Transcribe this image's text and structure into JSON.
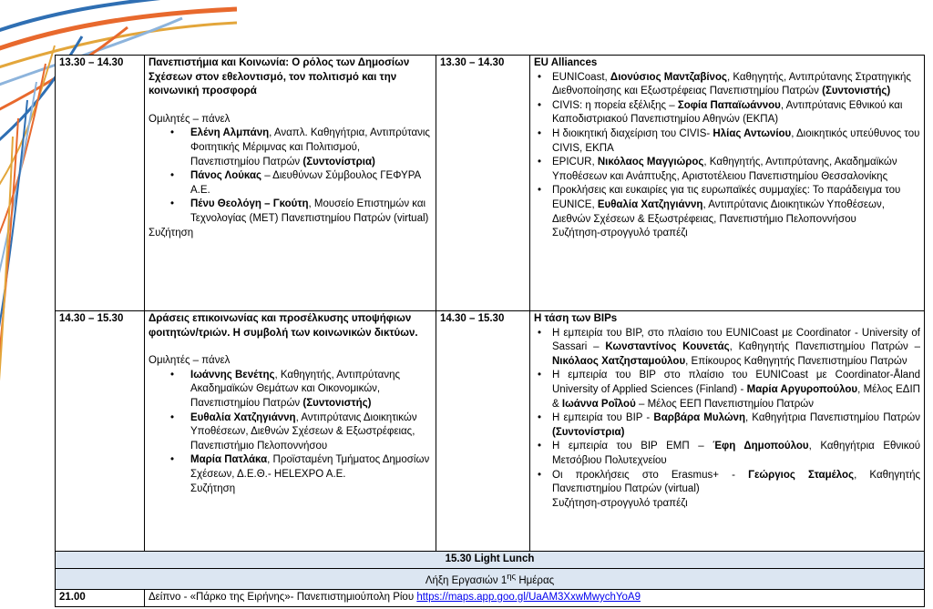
{
  "colors": {
    "band_bg": "#dce6f2",
    "link": "#0000ee",
    "deco_orange": "#e8692d",
    "deco_blue": "#2f6fb3",
    "deco_gold": "#e3a63b"
  },
  "row1": {
    "left": {
      "time": "13.30 – 14.30",
      "title": "Πανεπιστήμια και Κοινωνία: Ο ρόλος των Δημοσίων Σχέσεων στον εθελοντισμό, τον πολιτισμό και την κοινωνική προσφορά",
      "panel_label": "Ομιλητές – πάνελ",
      "speakers": [
        {
          "name": "Ελένη Αλμπάνη",
          "role": ", Αναπλ. Καθηγήτρια, Αντιπρύτανις Φοιτητικής Μέριμνας και Πολιτισμού, Πανεπιστημίου Πατρών ",
          "tag": "(Συντονίστρια)"
        },
        {
          "name": "Πάνος Λούκας",
          "role": " – Διευθύνων Σύμβουλος ΓΕΦΥΡΑ Α.Ε.",
          "tag": ""
        },
        {
          "name": "Πένυ Θεολόγη – Γκούτη",
          "role": ", Μουσείο Επιστημών και Τεχνολογίας (ΜΕΤ) Πανεπιστημίου Πατρών (virtual)",
          "tag": ""
        }
      ],
      "discussion": "Συζήτηση"
    },
    "right": {
      "time": "13.30 – 14.30",
      "title": "EU Alliances",
      "items": [
        {
          "pre": "EUNICoast, ",
          "bold": "Διονύσιος Μαντζαβίνος",
          "post": ", Καθηγητής, Αντιπρύτανης Στρατηγικής Διεθνοποίησης και Εξωστρέφειας Πανεπιστημίου Πατρών ",
          "tag": "(Συντονιστής)"
        },
        {
          "pre": "CIVIS: η πορεία εξέλιξης – ",
          "bold": "Σοφία Παπαϊωάννου",
          "post": ", Αντιπρύτανις Εθνικού και Καποδιστριακού Πανεπιστημίου Αθηνών (ΕΚΠΑ)",
          "tag": ""
        },
        {
          "pre": "Η διοικητική διαχείριση του CIVIS- ",
          "bold": "Ηλίας Αντωνίου",
          "post": ", Διοικητικός υπεύθυνος του CIVIS, ΕΚΠΑ",
          "tag": ""
        },
        {
          "pre": "EPICUR, ",
          "bold": "Νικόλαος Μαγγιώρος",
          "post": ", Καθηγητής, Αντιπρύτανης, Ακαδημαϊκών Υποθέσεων και Ανάπτυξης, Αριστοτέλειου Πανεπιστημίου Θεσσαλονίκης",
          "tag": ""
        },
        {
          "pre": "Προκλήσεις και ευκαιρίες για τις ευρωπαϊκές συμμαχίες: Το παράδειγμα του EUNICE, ",
          "bold": "Ευθαλία Χατζηγιάννη",
          "post": ", Αντιπρύτανις Διοικητικών Υποθέσεων, Διεθνών Σχέσεων & Εξωστρέφειας, Πανεπιστήμιο Πελοποννήσου",
          "tag": ""
        }
      ],
      "discussion": "Συζήτηση-στρογγυλό τραπέζι"
    }
  },
  "row2": {
    "left": {
      "time": "14.30 – 15.30",
      "title": "Δράσεις επικοινωνίας και προσέλκυσης υποψήφιων φοιτητών/τριών. Η συμβολή των κοινωνικών δικτύων.",
      "panel_label": "Ομιλητές – πάνελ",
      "speakers": [
        {
          "name": "Ιωάννης Βενέτης",
          "role": ", Καθηγητής, Αντιπρύτανης Ακαδημαϊκών Θεμάτων και Οικονομικών, Πανεπιστημίου Πατρών ",
          "tag": "(Συντονιστής)"
        },
        {
          "name": "Ευθαλία Χατζηγιάννη",
          "role": ", Αντιπρύτανις Διοικητικών Υποθέσεων, Διεθνών Σχέσεων & Εξωστρέφειας, Πανεπιστήμιο Πελοποννήσου",
          "tag": ""
        },
        {
          "name": "Μαρία Πατλάκα",
          "role": ", Προϊσταμένη Τμήματος Δημοσίων Σχέσεων, Δ.Ε.Θ.- HELEXPO A.E.",
          "tag": ""
        }
      ],
      "discussion": "Συζήτηση"
    },
    "right": {
      "time": "14.30 – 15.30",
      "title": "Η τάση των BIPs",
      "items": [
        {
          "pre": "Η εμπειρία του BIP, στο πλαίσιο του EUNICoast με Coordinator - University of Sassari – ",
          "bold": "Κωνσταντίνος Κουνετάς",
          "post": ", Καθηγητής Πανεπιστημίου Πατρών – ",
          "bold2": "Νικόλαος Χατζησταμούλου",
          "post2": ", Επίκουρος Καθηγητής Πανεπιστημίου Πατρών"
        },
        {
          "pre": "Η εμπειρία του BIP στο πλαίσιο του EUNICoast με Coordinator-Åland University of Applied Sciences (Finland) - ",
          "bold": "Μαρία Αργυροπούλου",
          "post": ", Μέλος ΕΔΙΠ & ",
          "bold2": "Ιωάννα Ροΐλού",
          "post2": " – Μέλος ΕΕΠ Πανεπιστημίου Πατρών"
        },
        {
          "pre": "Η εμπειρία του BIP - ",
          "bold": "Βαρβάρα Μυλώνη",
          "post": ", Καθηγήτρια Πανεπιστημίου Πατρών ",
          "bold2": "(Συντονίστρια)",
          "post2": ""
        },
        {
          "pre": "Η εμπειρία του BIP ΕΜΠ – ",
          "bold": "Έφη Δημοπούλου",
          "post": ", Καθηγήτρια Εθνικού Μετσόβιου Πολυτεχνείου",
          "bold2": "",
          "post2": ""
        },
        {
          "pre": "Οι προκλήσεις στο Erasmus+ - ",
          "bold": "Γεώργιος Σταμέλος",
          "post": ", Καθηγητής Πανεπιστημίου Πατρών (virtual)",
          "bold2": "",
          "post2": ""
        }
      ],
      "discussion": "Συζήτηση-στρογγυλό τραπέζι"
    }
  },
  "lunch": "15.30 Light Lunch",
  "end_day": {
    "pre": "Λήξη Εργασιών 1",
    "sup": "ης",
    "post": " Ημέρας"
  },
  "dinner": {
    "time": "21.00",
    "text": "Δείπνο - «Πάρκο της Ειρήνης»- Πανεπιστημιούπολη Ρίου ",
    "link": "https://maps.app.goo.gl/UaAM3XxwMwychYoA9"
  }
}
